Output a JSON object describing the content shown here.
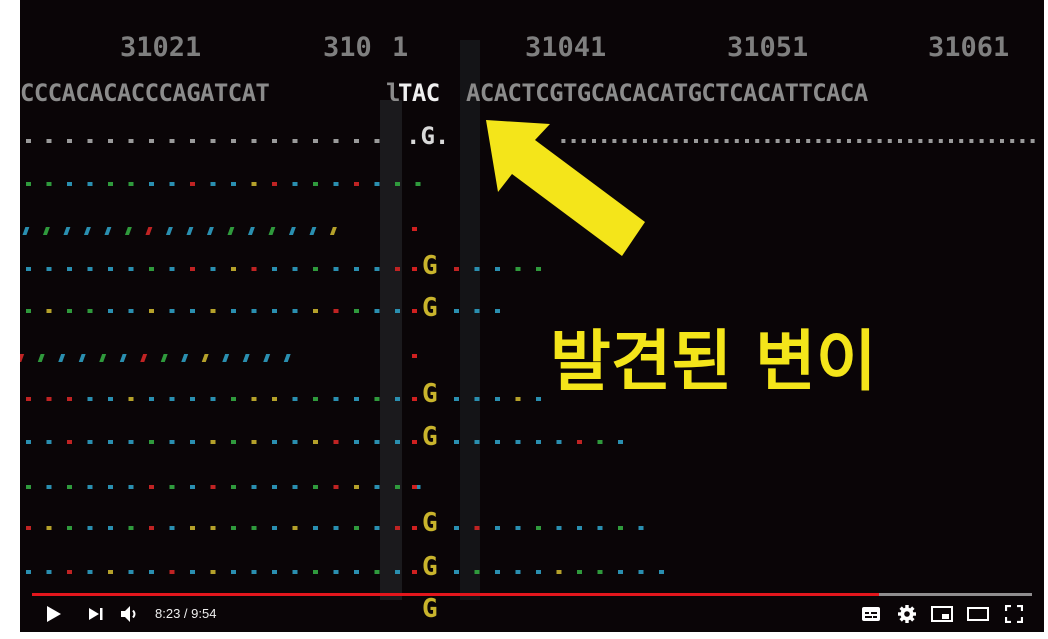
{
  "player": {
    "current_time": "8:23",
    "separator": " / ",
    "duration": "9:54",
    "progress_fraction": 0.8468,
    "buffered_fraction": 1.0,
    "progress_color": "#e3161c"
  },
  "video_frame": {
    "positions": [
      "31021",
      "310",
      "1",
      "31041",
      "31051",
      "31061"
    ],
    "reference_left": "CCCACACACCCAGATCAT",
    "reference_bracket": "l",
    "reference_highlight": "TAC",
    "reference_right": "ACACTCGTGCACACATGCTCACATTCACA",
    "first_row_variant": ".G.",
    "read_variants": [
      "G",
      "G",
      "G",
      "G",
      "G",
      "G",
      "G"
    ],
    "callout_text": "발견된 변이",
    "callout_color": "#f4e51a"
  },
  "controls": {
    "play_icon": "play-icon",
    "next_icon": "next-icon",
    "volume_icon": "volume-icon",
    "subtitles_icon": "subtitles-icon",
    "settings_icon": "gear-icon",
    "miniplayer_icon": "miniplayer-icon",
    "theater_icon": "theater-icon",
    "fullscreen_icon": "fullscreen-icon"
  }
}
